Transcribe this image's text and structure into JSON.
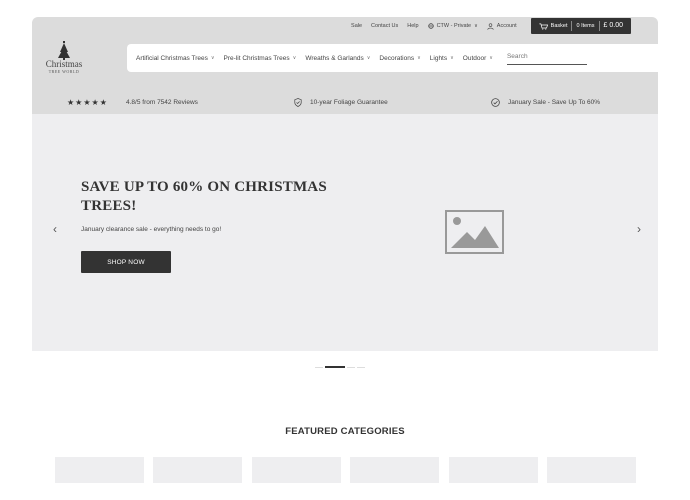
{
  "topbar": {
    "sale": "Sale",
    "contact": "Contact Us",
    "help": "Help",
    "region": "CTW - Private",
    "account": "Account",
    "basket_label": "Basket",
    "basket_items": "0 Items",
    "basket_total": "£ 0.00"
  },
  "logo": {
    "brand": "Christmas",
    "sub": "TREE WORLD"
  },
  "nav": {
    "items": [
      {
        "label": "Artificial Christmas Trees"
      },
      {
        "label": "Pre-lit Christmas Trees"
      },
      {
        "label": "Wreaths & Garlands"
      },
      {
        "label": "Decorations"
      },
      {
        "label": "Lights"
      },
      {
        "label": "Outdoor"
      }
    ],
    "search_placeholder": "Search"
  },
  "usp": {
    "stars": "★★★★★",
    "reviews": "4.8/5 from 7542 Reviews",
    "guarantee": "10-year Foliage Guarantee",
    "sale": "January Sale - Save Up To 60%"
  },
  "hero": {
    "title": "SAVE UP TO 60% ON CHRISTMAS TREES!",
    "subtitle": "January clearance sale - everything needs to go!",
    "cta": "SHOP NOW",
    "prev_glyph": "‹",
    "next_glyph": "›"
  },
  "featured": {
    "title": "FEATURED CATEGORIES"
  },
  "colors": {
    "header_bg": "#dcdcdc",
    "hero_bg": "#eeeef0",
    "dark": "#333333"
  }
}
